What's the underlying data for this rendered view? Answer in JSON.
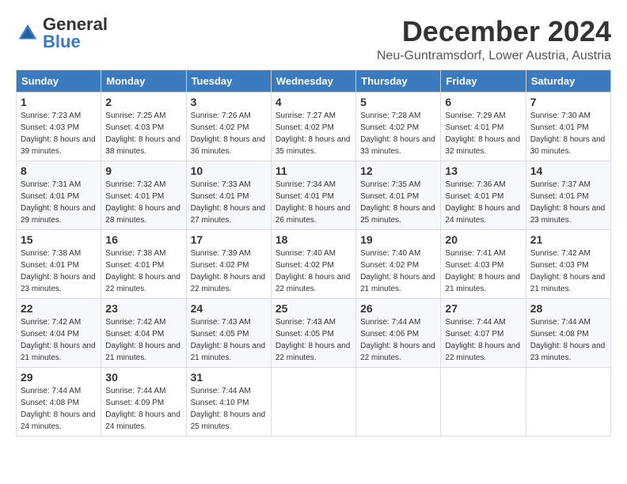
{
  "header": {
    "logo_general": "General",
    "logo_blue": "Blue",
    "month_title": "December 2024",
    "location": "Neu-Guntramsdorf, Lower Austria, Austria"
  },
  "weekdays": [
    "Sunday",
    "Monday",
    "Tuesday",
    "Wednesday",
    "Thursday",
    "Friday",
    "Saturday"
  ],
  "weeks": [
    [
      {
        "day": "1",
        "sunrise": "7:23 AM",
        "sunset": "4:03 PM",
        "daylight": "8 hours and 39 minutes."
      },
      {
        "day": "2",
        "sunrise": "7:25 AM",
        "sunset": "4:03 PM",
        "daylight": "8 hours and 38 minutes."
      },
      {
        "day": "3",
        "sunrise": "7:26 AM",
        "sunset": "4:02 PM",
        "daylight": "8 hours and 36 minutes."
      },
      {
        "day": "4",
        "sunrise": "7:27 AM",
        "sunset": "4:02 PM",
        "daylight": "8 hours and 35 minutes."
      },
      {
        "day": "5",
        "sunrise": "7:28 AM",
        "sunset": "4:02 PM",
        "daylight": "8 hours and 33 minutes."
      },
      {
        "day": "6",
        "sunrise": "7:29 AM",
        "sunset": "4:01 PM",
        "daylight": "8 hours and 32 minutes."
      },
      {
        "day": "7",
        "sunrise": "7:30 AM",
        "sunset": "4:01 PM",
        "daylight": "8 hours and 30 minutes."
      }
    ],
    [
      {
        "day": "8",
        "sunrise": "7:31 AM",
        "sunset": "4:01 PM",
        "daylight": "8 hours and 29 minutes."
      },
      {
        "day": "9",
        "sunrise": "7:32 AM",
        "sunset": "4:01 PM",
        "daylight": "8 hours and 28 minutes."
      },
      {
        "day": "10",
        "sunrise": "7:33 AM",
        "sunset": "4:01 PM",
        "daylight": "8 hours and 27 minutes."
      },
      {
        "day": "11",
        "sunrise": "7:34 AM",
        "sunset": "4:01 PM",
        "daylight": "8 hours and 26 minutes."
      },
      {
        "day": "12",
        "sunrise": "7:35 AM",
        "sunset": "4:01 PM",
        "daylight": "8 hours and 25 minutes."
      },
      {
        "day": "13",
        "sunrise": "7:36 AM",
        "sunset": "4:01 PM",
        "daylight": "8 hours and 24 minutes."
      },
      {
        "day": "14",
        "sunrise": "7:37 AM",
        "sunset": "4:01 PM",
        "daylight": "8 hours and 23 minutes."
      }
    ],
    [
      {
        "day": "15",
        "sunrise": "7:38 AM",
        "sunset": "4:01 PM",
        "daylight": "8 hours and 23 minutes."
      },
      {
        "day": "16",
        "sunrise": "7:38 AM",
        "sunset": "4:01 PM",
        "daylight": "8 hours and 22 minutes."
      },
      {
        "day": "17",
        "sunrise": "7:39 AM",
        "sunset": "4:02 PM",
        "daylight": "8 hours and 22 minutes."
      },
      {
        "day": "18",
        "sunrise": "7:40 AM",
        "sunset": "4:02 PM",
        "daylight": "8 hours and 22 minutes."
      },
      {
        "day": "19",
        "sunrise": "7:40 AM",
        "sunset": "4:02 PM",
        "daylight": "8 hours and 21 minutes."
      },
      {
        "day": "20",
        "sunrise": "7:41 AM",
        "sunset": "4:03 PM",
        "daylight": "8 hours and 21 minutes."
      },
      {
        "day": "21",
        "sunrise": "7:42 AM",
        "sunset": "4:03 PM",
        "daylight": "8 hours and 21 minutes."
      }
    ],
    [
      {
        "day": "22",
        "sunrise": "7:42 AM",
        "sunset": "4:04 PM",
        "daylight": "8 hours and 21 minutes."
      },
      {
        "day": "23",
        "sunrise": "7:42 AM",
        "sunset": "4:04 PM",
        "daylight": "8 hours and 21 minutes."
      },
      {
        "day": "24",
        "sunrise": "7:43 AM",
        "sunset": "4:05 PM",
        "daylight": "8 hours and 21 minutes."
      },
      {
        "day": "25",
        "sunrise": "7:43 AM",
        "sunset": "4:05 PM",
        "daylight": "8 hours and 22 minutes."
      },
      {
        "day": "26",
        "sunrise": "7:44 AM",
        "sunset": "4:06 PM",
        "daylight": "8 hours and 22 minutes."
      },
      {
        "day": "27",
        "sunrise": "7:44 AM",
        "sunset": "4:07 PM",
        "daylight": "8 hours and 22 minutes."
      },
      {
        "day": "28",
        "sunrise": "7:44 AM",
        "sunset": "4:08 PM",
        "daylight": "8 hours and 23 minutes."
      }
    ],
    [
      {
        "day": "29",
        "sunrise": "7:44 AM",
        "sunset": "4:08 PM",
        "daylight": "8 hours and 24 minutes."
      },
      {
        "day": "30",
        "sunrise": "7:44 AM",
        "sunset": "4:09 PM",
        "daylight": "8 hours and 24 minutes."
      },
      {
        "day": "31",
        "sunrise": "7:44 AM",
        "sunset": "4:10 PM",
        "daylight": "8 hours and 25 minutes."
      },
      null,
      null,
      null,
      null
    ]
  ],
  "labels": {
    "sunrise": "Sunrise:",
    "sunset": "Sunset:",
    "daylight": "Daylight:"
  }
}
